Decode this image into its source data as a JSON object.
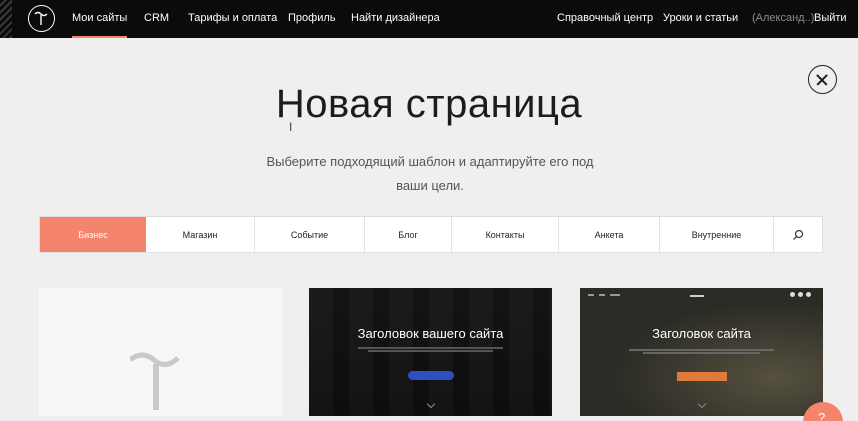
{
  "nav": {
    "left": [
      "Мои сайты",
      "CRM",
      "Тарифы и оплата",
      "Профиль",
      "Найти дизайнера"
    ],
    "right": [
      "Справочный центр",
      "Уроки и статьи"
    ],
    "user": "(Александ..)",
    "logout": "Выйти"
  },
  "header": {
    "title": "Новая страница",
    "subtitle_line1": "Выберите подходящий шаблон и адаптируйте его под",
    "subtitle_line2": "ваши цели."
  },
  "tabs": [
    "Бизнес",
    "Магазин",
    "Событие",
    "Блог",
    "Контакты",
    "Анкета",
    "Внутренние"
  ],
  "cards": {
    "card1_title": "Заголовок вашего сайта",
    "card2_title": "Заголовок сайта"
  },
  "colors": {
    "accent": "#f4846b",
    "topbar": "#0b0b0b",
    "background": "#efefef"
  },
  "icons": [
    "tilda-logo-icon",
    "close-icon",
    "search-icon",
    "chevron-down-icon",
    "help-icon"
  ]
}
